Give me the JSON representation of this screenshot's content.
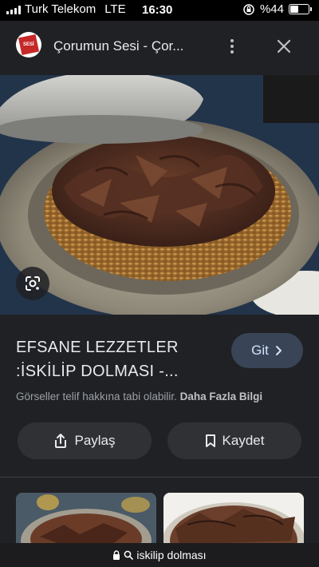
{
  "status_bar": {
    "carrier": "Turk Telekom",
    "network": "LTE",
    "time": "16:30",
    "battery": "%44",
    "battery_level": 0.44
  },
  "header": {
    "site_name": "Çorumun Sesi - Çor...",
    "logo_text": "SESİ"
  },
  "result": {
    "title_line1": "EFSANE LEZZETLER",
    "title_line2": ":İSKİLİP DOLMASI -...",
    "go_label": "Git",
    "copyright_text": "Görseller telif hakkına tabi olabilir.",
    "more_info_link": "Daha Fazla Bilgi"
  },
  "actions": {
    "share_label": "Paylaş",
    "save_label": "Kaydet"
  },
  "url_bar": {
    "text": "iskilip dolması"
  },
  "icons": {
    "more": "more-vertical-icon",
    "close": "close-icon",
    "lens": "google-lens-icon",
    "share": "share-icon",
    "bookmark": "bookmark-icon",
    "chevron": "chevron-right-icon",
    "lock": "lock-icon",
    "search": "search-icon"
  },
  "colors": {
    "background": "#202124",
    "go_button_bg": "#394457",
    "go_button_text": "#d2e3fc",
    "action_button_bg": "#303134"
  }
}
